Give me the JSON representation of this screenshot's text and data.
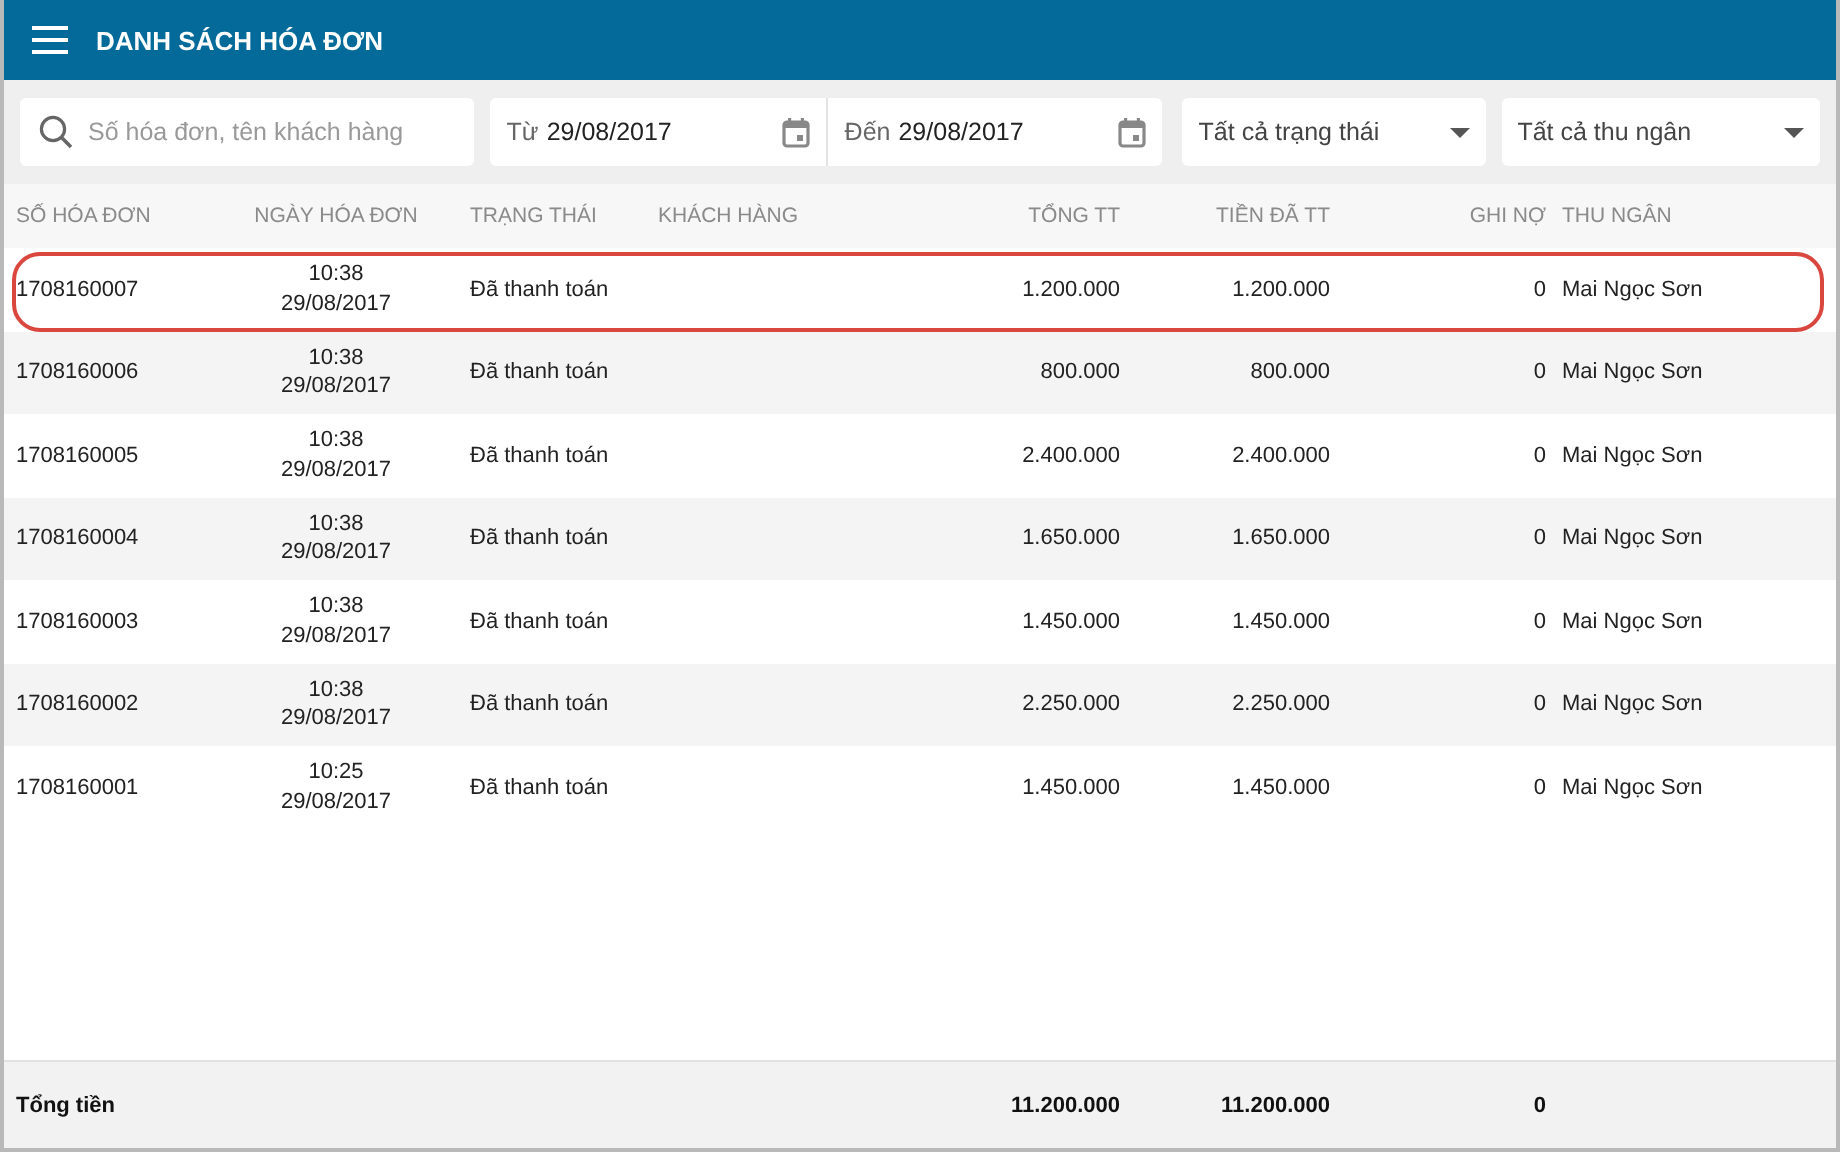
{
  "app_bar": {
    "title": "DANH SÁCH HÓA ĐƠN"
  },
  "filters": {
    "search": {
      "placeholder": "Số hóa đơn, tên khách hàng"
    },
    "from_date": {
      "label": "Từ",
      "value": "29/08/2017"
    },
    "to_date": {
      "label": "Đến",
      "value": "29/08/2017"
    },
    "status_select": {
      "value": "Tất cả trạng thái"
    },
    "cashier_select": {
      "value": "Tất cả thu ngân"
    }
  },
  "table": {
    "columns": [
      "SỐ HÓA ĐƠN",
      "NGÀY HÓA ĐƠN",
      "TRẠNG THÁI",
      "KHÁCH HÀNG",
      "TỔNG TT",
      "TIỀN ĐÃ TT",
      "GHI NỢ",
      "THU NGÂN"
    ],
    "rows": [
      {
        "invoice": "1708160007",
        "time": "10:38",
        "date": "29/08/2017",
        "status": "Đã thanh toán",
        "customer": "",
        "total": "1.200.000",
        "paid": "1.200.000",
        "debt": "0",
        "cashier": "Mai Ngọc Sơn",
        "highlighted": true
      },
      {
        "invoice": "1708160006",
        "time": "10:38",
        "date": "29/08/2017",
        "status": "Đã thanh toán",
        "customer": "",
        "total": "800.000",
        "paid": "800.000",
        "debt": "0",
        "cashier": "Mai Ngọc Sơn",
        "highlighted": false
      },
      {
        "invoice": "1708160005",
        "time": "10:38",
        "date": "29/08/2017",
        "status": "Đã thanh toán",
        "customer": "",
        "total": "2.400.000",
        "paid": "2.400.000",
        "debt": "0",
        "cashier": "Mai Ngọc Sơn",
        "highlighted": false
      },
      {
        "invoice": "1708160004",
        "time": "10:38",
        "date": "29/08/2017",
        "status": "Đã thanh toán",
        "customer": "",
        "total": "1.650.000",
        "paid": "1.650.000",
        "debt": "0",
        "cashier": "Mai Ngọc Sơn",
        "highlighted": false
      },
      {
        "invoice": "1708160003",
        "time": "10:38",
        "date": "29/08/2017",
        "status": "Đã thanh toán",
        "customer": "",
        "total": "1.450.000",
        "paid": "1.450.000",
        "debt": "0",
        "cashier": "Mai Ngọc Sơn",
        "highlighted": false
      },
      {
        "invoice": "1708160002",
        "time": "10:38",
        "date": "29/08/2017",
        "status": "Đã thanh toán",
        "customer": "",
        "total": "2.250.000",
        "paid": "2.250.000",
        "debt": "0",
        "cashier": "Mai Ngọc Sơn",
        "highlighted": false
      },
      {
        "invoice": "1708160001",
        "time": "10:25",
        "date": "29/08/2017",
        "status": "Đã thanh toán",
        "customer": "",
        "total": "1.450.000",
        "paid": "1.450.000",
        "debt": "0",
        "cashier": "Mai Ngọc Sơn",
        "highlighted": false
      }
    ],
    "footer": {
      "label": "Tổng tiền",
      "total": "11.200.000",
      "paid": "11.200.000",
      "debt": "0"
    }
  }
}
